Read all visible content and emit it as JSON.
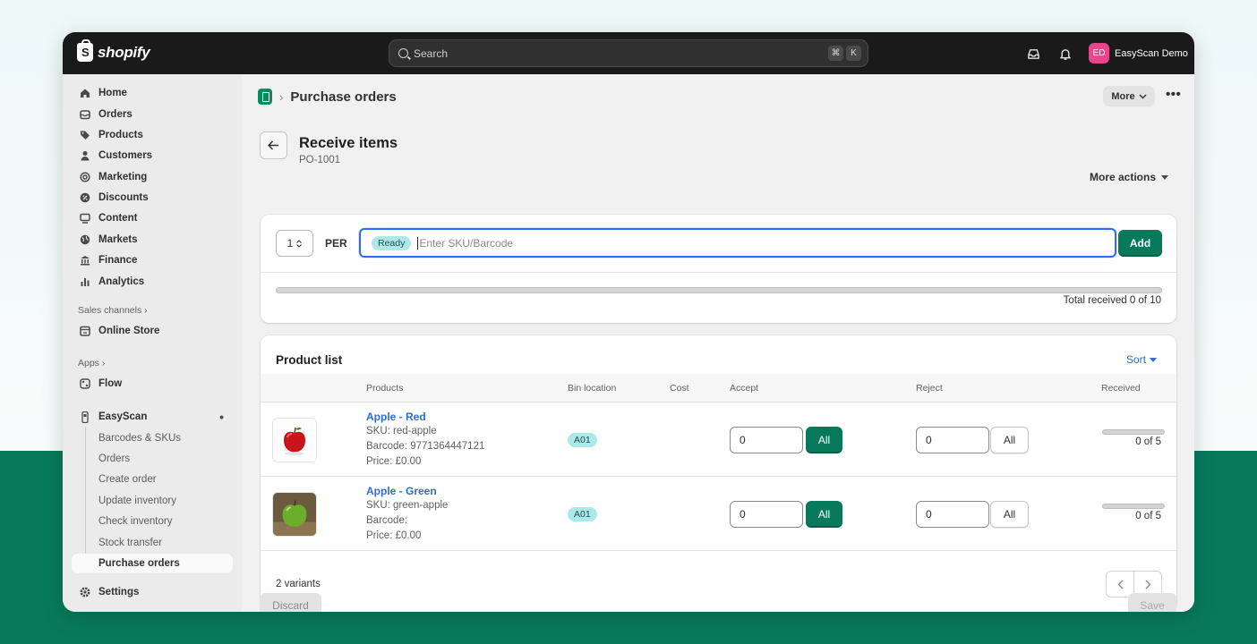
{
  "topbar": {
    "logo_text": "shopify",
    "search_placeholder": "Search",
    "kbd_cmd": "⌘",
    "kbd_k": "K",
    "avatar_initials": "ED",
    "store_name": "EasyScan Demo",
    "avatar_color": "#e8468a"
  },
  "sidebar": {
    "items": [
      {
        "label": "Home",
        "icon": "home-icon"
      },
      {
        "label": "Orders",
        "icon": "inbox-icon"
      },
      {
        "label": "Products",
        "icon": "tag-icon"
      },
      {
        "label": "Customers",
        "icon": "person-icon"
      },
      {
        "label": "Marketing",
        "icon": "target-icon"
      },
      {
        "label": "Discounts",
        "icon": "discount-icon"
      },
      {
        "label": "Content",
        "icon": "content-icon"
      },
      {
        "label": "Markets",
        "icon": "globe-icon"
      },
      {
        "label": "Finance",
        "icon": "bank-icon"
      },
      {
        "label": "Analytics",
        "icon": "bar-chart-icon"
      }
    ],
    "sales_channels_label": "Sales channels",
    "online_store": "Online Store",
    "apps_label": "Apps",
    "flow": "Flow",
    "easyscan": "EasyScan",
    "easyscan_subitems": [
      "Barcodes & SKUs",
      "Orders",
      "Create order",
      "Update inventory",
      "Check inventory",
      "Stock transfer",
      "Purchase orders"
    ],
    "settings": "Settings"
  },
  "header": {
    "breadcrumb": "Purchase orders",
    "more_label": "More"
  },
  "page": {
    "title": "Receive items",
    "subtitle": "PO-1001",
    "more_actions": "More actions"
  },
  "scan": {
    "quantity": "1",
    "per_label": "PER",
    "status_badge": "Ready",
    "placeholder": "Enter SKU/Barcode",
    "add_label": "Add",
    "total_received": "Total received 0 of 10",
    "progress_fraction": 0
  },
  "product_list": {
    "title": "Product list",
    "sort_label": "Sort",
    "columns": [
      "Products",
      "Bin location",
      "Cost",
      "Accept",
      "Reject",
      "Received"
    ],
    "rows": [
      {
        "name": "Apple - Red",
        "sku": "SKU: red-apple",
        "barcode": "Barcode: 9771364447121",
        "price": "Price: £0.00",
        "bin": "A01",
        "accept": "0",
        "accept_all": "All",
        "reject": "0",
        "reject_all": "All",
        "received": "0 of 5",
        "received_fraction": 0
      },
      {
        "name": "Apple - Green",
        "sku": "SKU: green-apple",
        "barcode": "Barcode:",
        "price": "Price: £0.00",
        "bin": "A01",
        "accept": "0",
        "accept_all": "All",
        "reject": "0",
        "reject_all": "All",
        "received": "0 of 5",
        "received_fraction": 0
      }
    ],
    "variants_count": "2 variants"
  },
  "footer": {
    "discard": "Discard",
    "save": "Save"
  },
  "colors": {
    "primary": "#087a5b",
    "link": "#2c6ecb",
    "badge": "#aee9ea"
  }
}
